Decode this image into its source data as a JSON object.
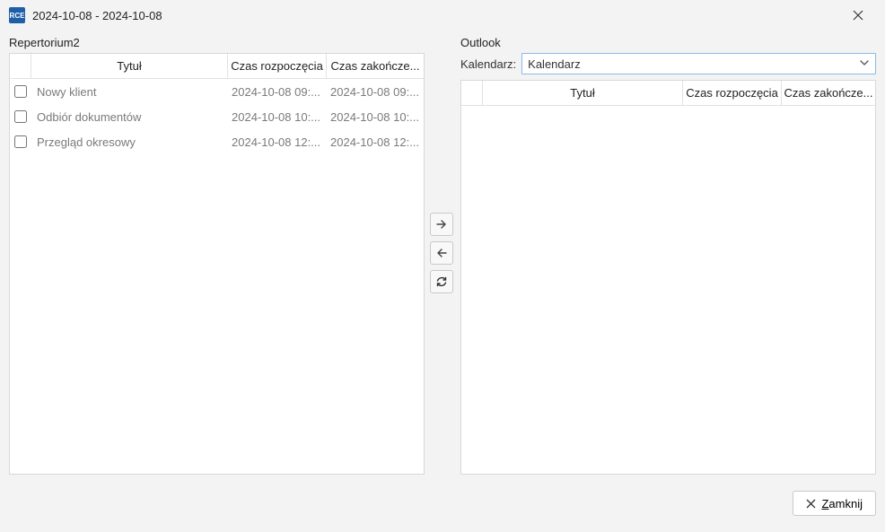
{
  "window": {
    "title": "2024-10-08 - 2024-10-08",
    "app_icon_text": "RCE"
  },
  "left": {
    "label": "Repertorium2",
    "columns": {
      "title": "Tytuł",
      "start": "Czas rozpoczęcia",
      "end": "Czas zakończe..."
    },
    "rows": [
      {
        "title": "Nowy klient",
        "start": "2024-10-08 09:...",
        "end": "2024-10-08 09:..."
      },
      {
        "title": "Odbiór dokumentów",
        "start": "2024-10-08 10:...",
        "end": "2024-10-08 10:..."
      },
      {
        "title": "Przegląd okresowy",
        "start": "2024-10-08 12:...",
        "end": "2024-10-08 12:..."
      }
    ]
  },
  "right": {
    "label": "Outlook",
    "calendar_label": "Kalendarz:",
    "calendar_value": "Kalendarz",
    "columns": {
      "title": "Tytuł",
      "start": "Czas rozpoczęcia",
      "end": "Czas zakończe..."
    }
  },
  "footer": {
    "close_label": "Zamknij"
  }
}
